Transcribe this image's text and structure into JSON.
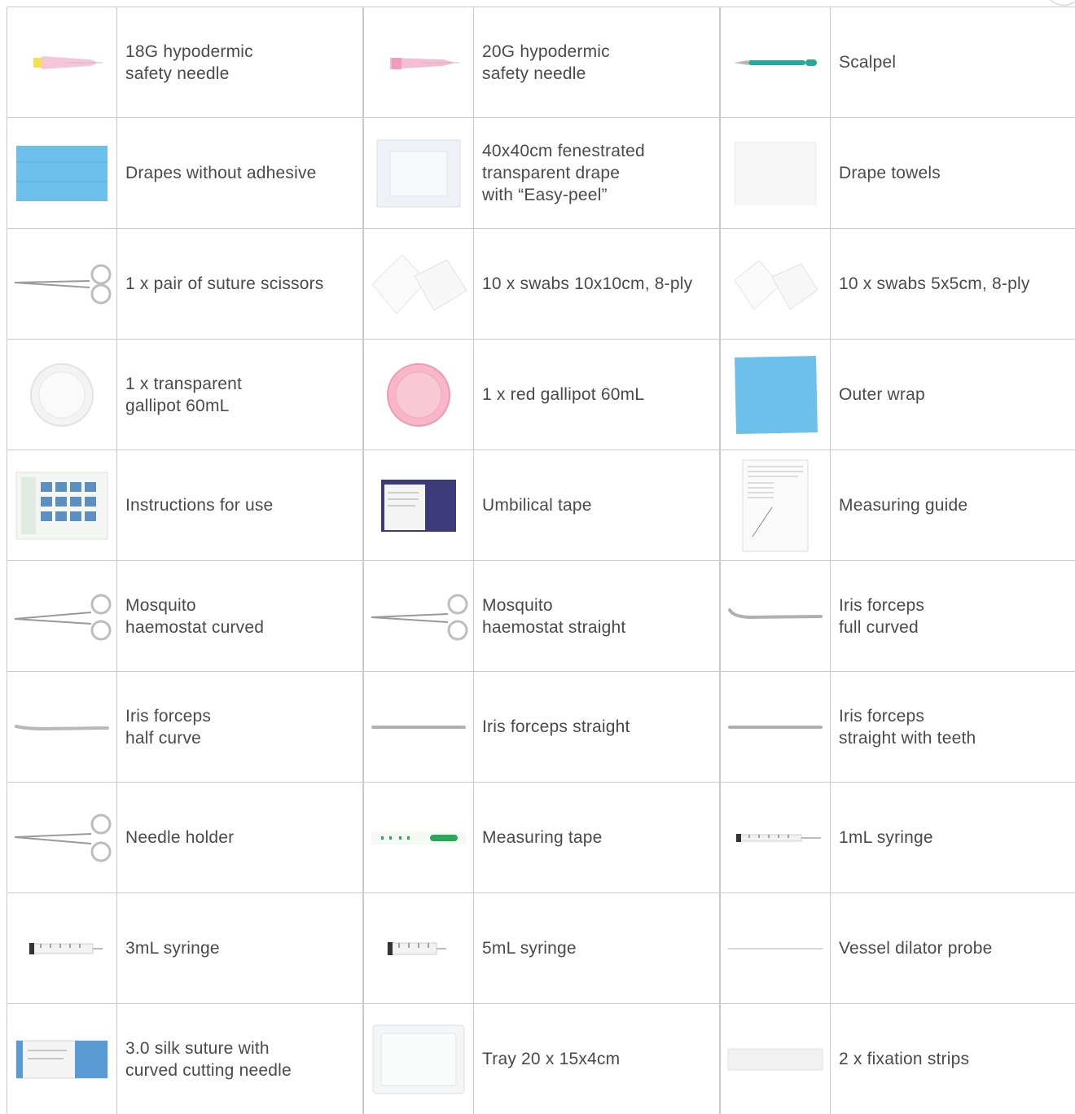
{
  "rows": [
    [
      {
        "label": "18G hypodermic\nsafety needle",
        "icon": "needle-yellow-icon"
      },
      {
        "label": "20G hypodermic\nsafety needle",
        "icon": "needle-pink-icon"
      },
      {
        "label": "Scalpel",
        "icon": "scalpel-icon"
      }
    ],
    [
      {
        "label": "Drapes without adhesive",
        "icon": "blue-drape-icon"
      },
      {
        "label": "40x40cm fenestrated\ntransparent drape\nwith “Easy-peel”",
        "icon": "transparent-drape-icon"
      },
      {
        "label": "Drape towels",
        "icon": "drape-towel-icon"
      }
    ],
    [
      {
        "label": "1 x pair of suture scissors",
        "icon": "scissors-icon"
      },
      {
        "label": "10 x swabs 10x10cm, 8-ply",
        "icon": "swabs-large-icon"
      },
      {
        "label": "10 x swabs 5x5cm, 8-ply",
        "icon": "swabs-small-icon"
      }
    ],
    [
      {
        "label": "1 x transparent\ngallipot 60mL",
        "icon": "transparent-gallipot-icon"
      },
      {
        "label": "1 x red gallipot 60mL",
        "icon": "red-gallipot-icon"
      },
      {
        "label": "Outer wrap",
        "icon": "outer-wrap-icon"
      }
    ],
    [
      {
        "label": "Instructions for use",
        "icon": "instructions-leaflet-icon"
      },
      {
        "label": "Umbilical tape",
        "icon": "umbilical-tape-icon"
      },
      {
        "label": "Measuring guide",
        "icon": "measuring-guide-icon"
      }
    ],
    [
      {
        "label": "Mosquito\nhaemostat curved",
        "icon": "haemostat-curved-icon"
      },
      {
        "label": "Mosquito\nhaemostat straight",
        "icon": "haemostat-straight-icon"
      },
      {
        "label": "Iris forceps\nfull curved",
        "icon": "forceps-full-curved-icon"
      }
    ],
    [
      {
        "label": "Iris forceps\nhalf curve",
        "icon": "forceps-half-curve-icon"
      },
      {
        "label": "Iris forceps straight",
        "icon": "forceps-straight-icon"
      },
      {
        "label": "Iris forceps\nstraight with teeth",
        "icon": "forceps-teeth-icon"
      }
    ],
    [
      {
        "label": "Needle holder",
        "icon": "needle-holder-icon"
      },
      {
        "label": "Measuring tape",
        "icon": "measuring-tape-icon"
      },
      {
        "label": "1mL syringe",
        "icon": "syringe-1ml-icon"
      }
    ],
    [
      {
        "label": "3mL syringe",
        "icon": "syringe-3ml-icon"
      },
      {
        "label": "5mL syringe",
        "icon": "syringe-5ml-icon"
      },
      {
        "label": "Vessel dilator probe",
        "icon": "dilator-probe-icon"
      }
    ],
    [
      {
        "label": "3.0 silk suture with\ncurved cutting needle",
        "icon": "silk-suture-pack-icon"
      },
      {
        "label": "Tray 20 x 15x4cm",
        "icon": "tray-icon"
      },
      {
        "label": "2 x fixation strips",
        "icon": "fixation-strips-icon"
      }
    ]
  ],
  "colors": {
    "text": "#4a4a4a",
    "grid_line": "#c9c9c9",
    "drape_blue": "#6cc0ea",
    "gallipot_pink": "#f7b7c8",
    "tape_navy": "#3d3a7a",
    "scalpel_teal": "#2aa79b"
  }
}
